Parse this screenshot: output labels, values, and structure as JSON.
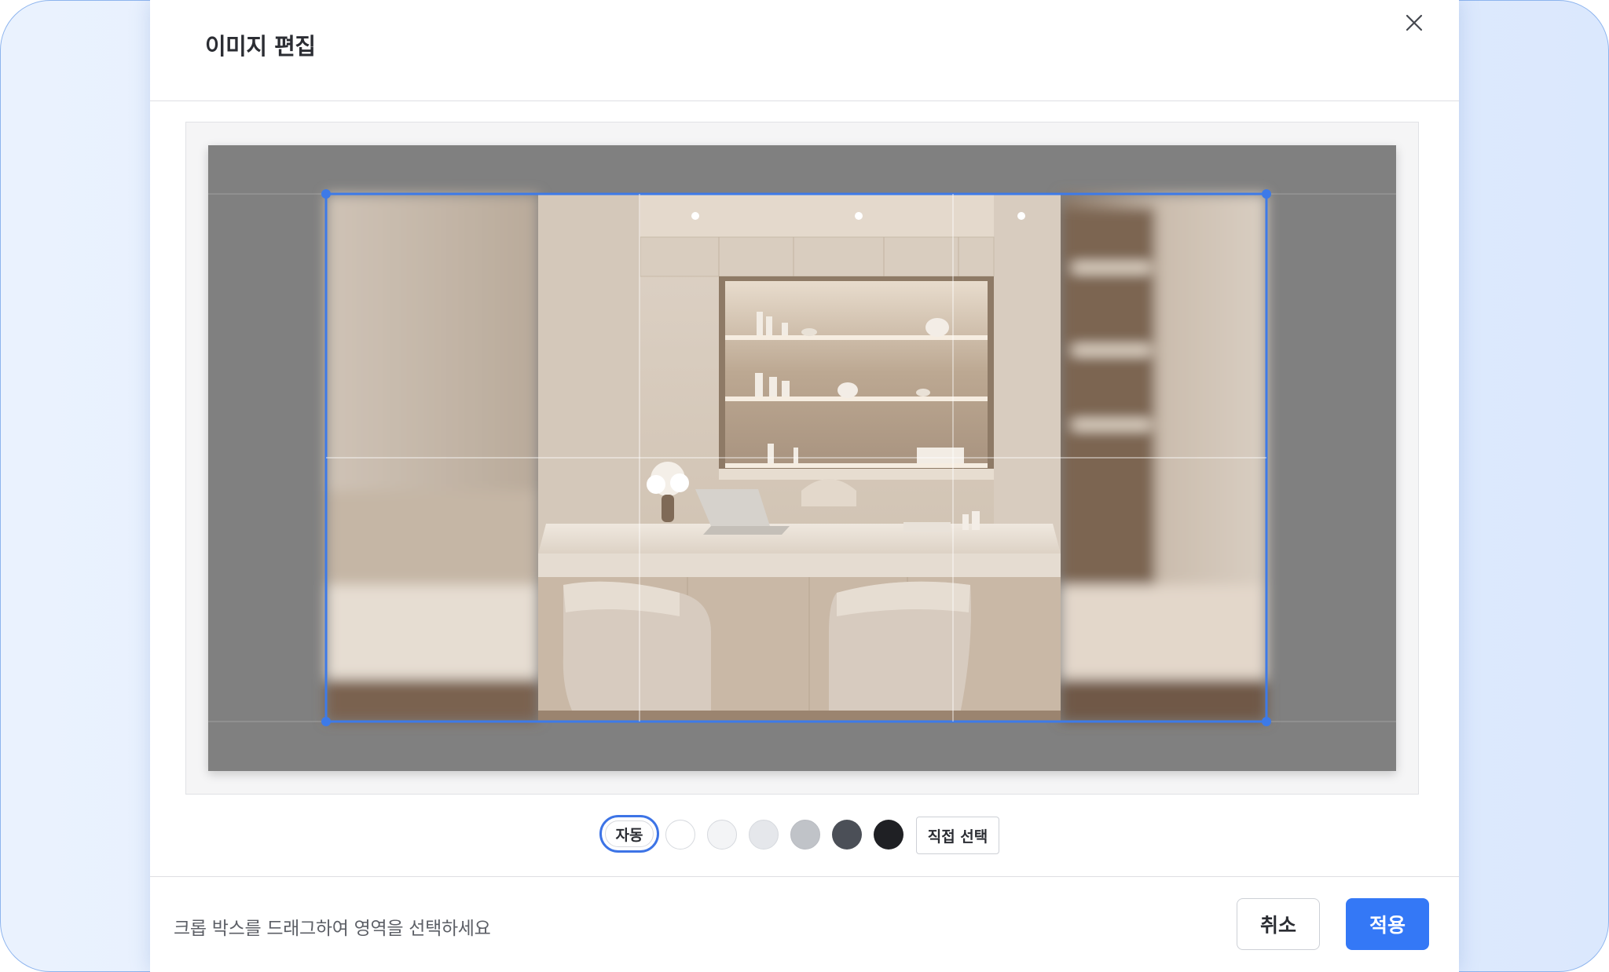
{
  "modal": {
    "title": "이미지 편집",
    "close_icon": "close-icon"
  },
  "editor": {
    "image_description_icon": "interior-photo",
    "crop_handle_color": "#3d7ae8",
    "overlay_color": "#808080"
  },
  "background_options": {
    "auto_label": "자동",
    "swatches": [
      {
        "name": "white",
        "color": "#ffffff"
      },
      {
        "name": "off-white",
        "color": "#f3f4f6"
      },
      {
        "name": "light-gray",
        "color": "#e5e7eb"
      },
      {
        "name": "gray",
        "color": "#c0c3c8"
      },
      {
        "name": "dark-gray",
        "color": "#4b4f57"
      },
      {
        "name": "black",
        "color": "#1f2024"
      }
    ],
    "direct_label": "직접 선택"
  },
  "footer": {
    "hint": "크롭 박스를 드래그하여 영역을 선택하세요",
    "cancel_label": "취소",
    "apply_label": "적용"
  },
  "colors": {
    "accent": "#3478f6",
    "frame_border": "#8db4ee"
  }
}
